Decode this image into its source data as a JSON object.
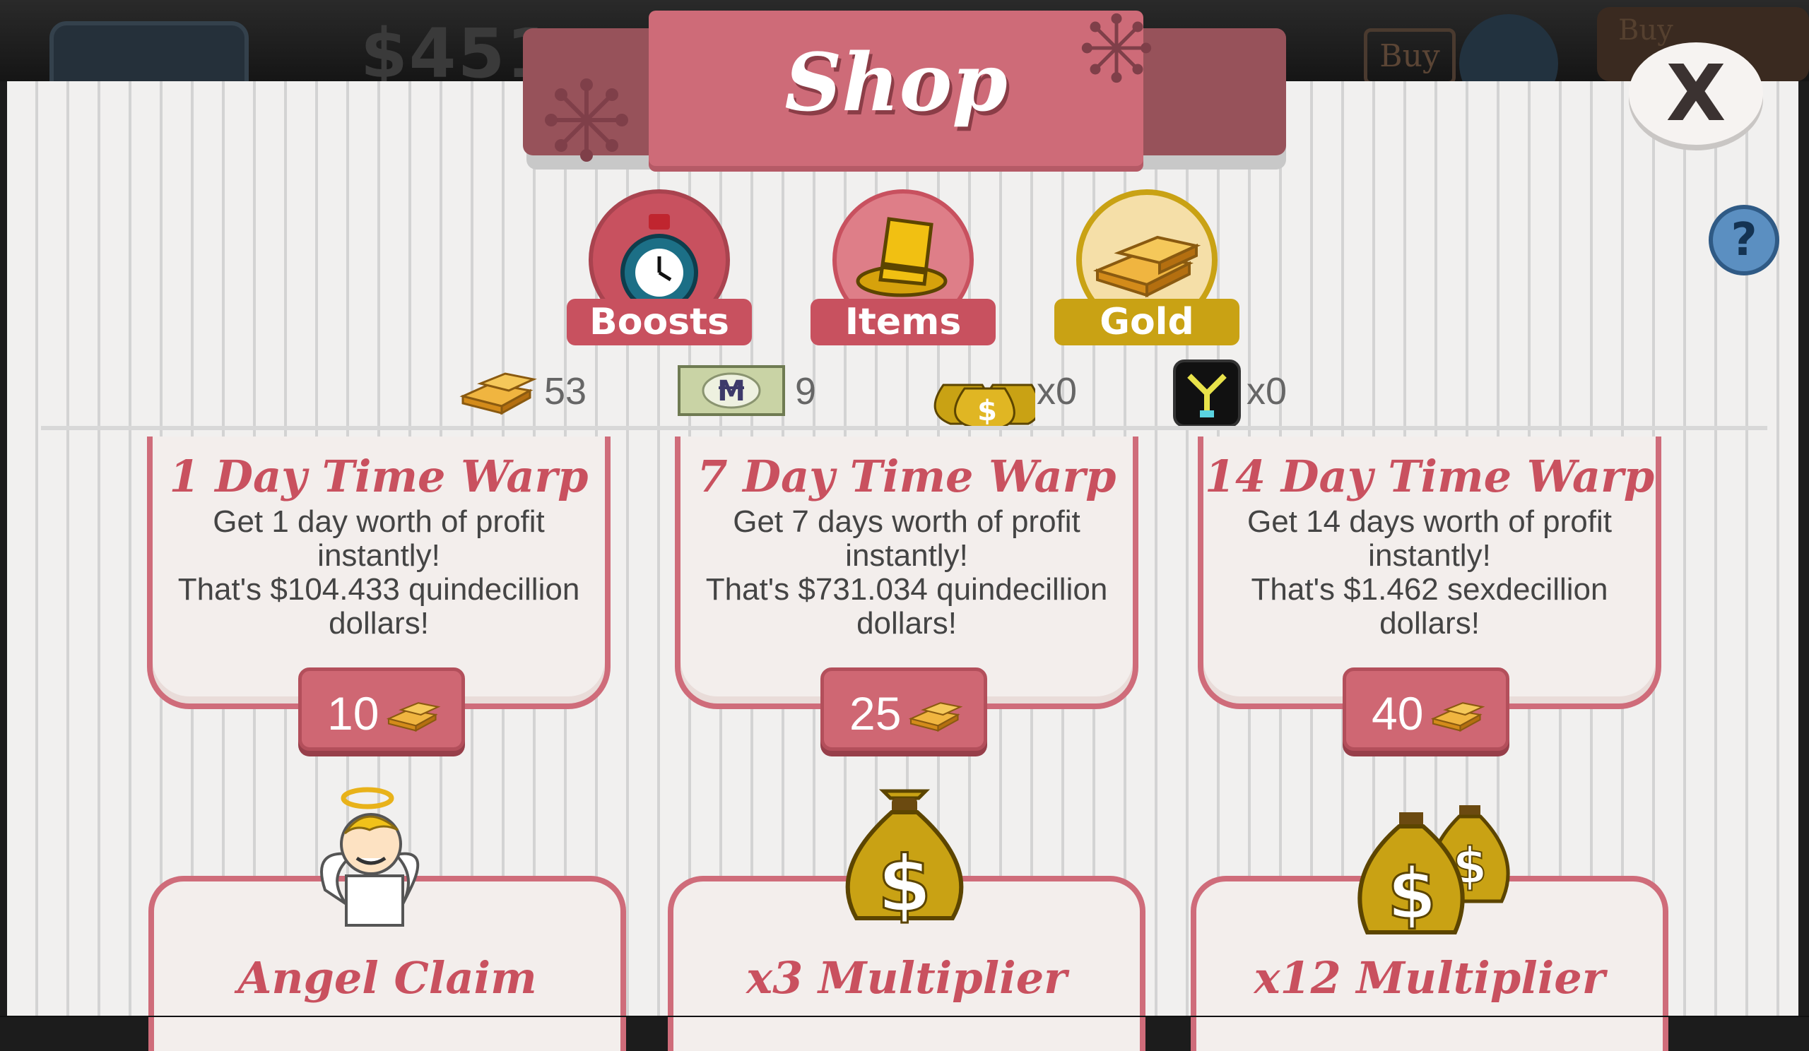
{
  "background": {
    "money_display": "$451",
    "buy_label": "Buy",
    "buy_tag_label": "Buy"
  },
  "shop": {
    "title": "Shop",
    "close_label": "X",
    "help_label": "?",
    "tabs": [
      {
        "label": "Boosts",
        "icon": "stopwatch-icon",
        "color": "#c8515f",
        "selected": false
      },
      {
        "label": "Items",
        "icon": "top-hat-icon",
        "color": "#c8515f",
        "selected": false
      },
      {
        "label": "Gold",
        "icon": "gold-bars-icon",
        "color": "#c9a214",
        "selected": true
      }
    ],
    "currencies": [
      {
        "icon": "gold-bars-icon",
        "value": "53"
      },
      {
        "icon": "megabucks-bill-icon",
        "value": "9"
      },
      {
        "icon": "money-bags-icon",
        "value": "x0"
      },
      {
        "icon": "flux-capacitor-icon",
        "value": "x0"
      }
    ],
    "offers": [
      {
        "title": "1 Day Time Warp",
        "line1": "Get 1 day worth of profit",
        "line2": "instantly!",
        "line3": "That's $104.433 quindecillion",
        "line4": "dollars!",
        "price": "10"
      },
      {
        "title": "7 Day Time Warp",
        "line1": "Get 7 days worth of profit",
        "line2": "instantly!",
        "line3": "That's $731.034 quindecillion",
        "line4": "dollars!",
        "price": "25"
      },
      {
        "title": "14 Day Time Warp",
        "line1": "Get 14 days worth of profit",
        "line2": "instantly!",
        "line3": "That's $1.462 sexdecillion",
        "line4": "dollars!",
        "price": "40"
      }
    ],
    "offers_row2": [
      {
        "title": "Angel Claim",
        "icon": "angel-icon"
      },
      {
        "title": "x3 Multiplier",
        "icon": "money-bag-icon"
      },
      {
        "title": "x12 Multiplier",
        "icon": "two-money-bags-icon"
      }
    ],
    "colors": {
      "accent_red": "#cf6c7a",
      "gold": "#c9a214",
      "panel_bg": "#f1f0ef"
    }
  }
}
